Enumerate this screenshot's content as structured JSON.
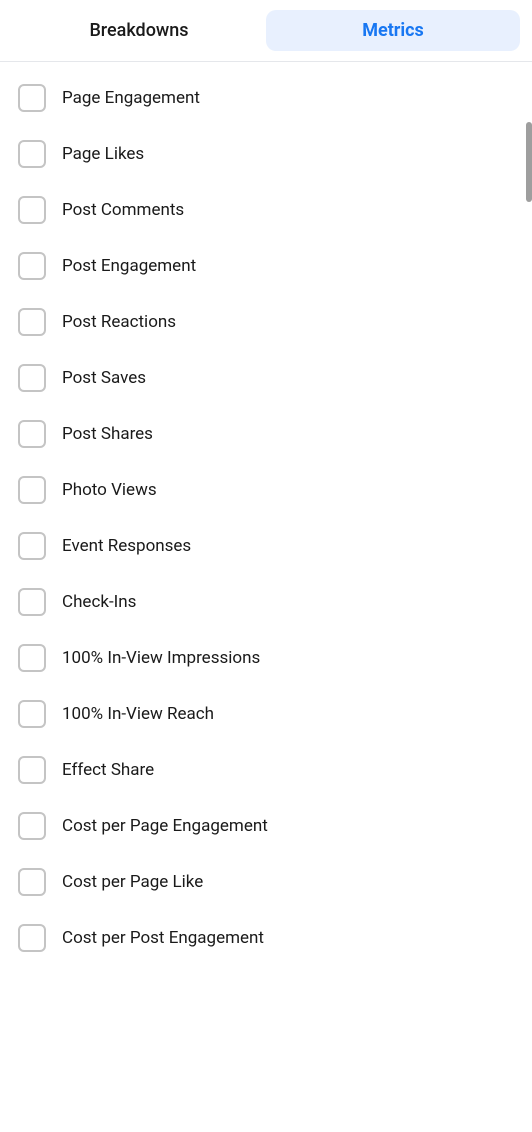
{
  "tabs": {
    "breakdowns": {
      "label": "Breakdowns",
      "active": false
    },
    "metrics": {
      "label": "Metrics",
      "active": true
    }
  },
  "items": [
    {
      "id": "page-engagement",
      "label": "Page Engagement",
      "checked": false
    },
    {
      "id": "page-likes",
      "label": "Page Likes",
      "checked": false
    },
    {
      "id": "post-comments",
      "label": "Post Comments",
      "checked": false
    },
    {
      "id": "post-engagement",
      "label": "Post Engagement",
      "checked": false
    },
    {
      "id": "post-reactions",
      "label": "Post Reactions",
      "checked": false
    },
    {
      "id": "post-saves",
      "label": "Post Saves",
      "checked": false
    },
    {
      "id": "post-shares",
      "label": "Post Shares",
      "checked": false
    },
    {
      "id": "photo-views",
      "label": "Photo Views",
      "checked": false
    },
    {
      "id": "event-responses",
      "label": "Event Responses",
      "checked": false
    },
    {
      "id": "check-ins",
      "label": "Check-Ins",
      "checked": false
    },
    {
      "id": "100-in-view-impressions",
      "label": "100% In-View Impressions",
      "checked": false
    },
    {
      "id": "100-in-view-reach",
      "label": "100% In-View Reach",
      "checked": false
    },
    {
      "id": "effect-share",
      "label": "Effect Share",
      "checked": false
    },
    {
      "id": "cost-per-page-engagement",
      "label": "Cost per Page Engagement",
      "checked": false
    },
    {
      "id": "cost-per-page-like",
      "label": "Cost per Page Like",
      "checked": false
    },
    {
      "id": "cost-per-post-engagement",
      "label": "Cost per Post Engagement",
      "checked": false
    }
  ]
}
